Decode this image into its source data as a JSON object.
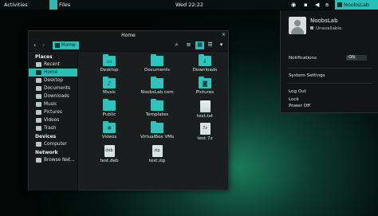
{
  "topbar": {
    "activities": "Activities",
    "app_name": "Files",
    "clock": "Wed 22:22",
    "user": "NoobsLab"
  },
  "window": {
    "title": "Home",
    "close": "×",
    "path": "Home"
  },
  "sidebar": {
    "places_header": "Places",
    "places": [
      {
        "label": "Recent",
        "selected": false
      },
      {
        "label": "Home",
        "selected": true
      },
      {
        "label": "Desktop",
        "selected": false
      },
      {
        "label": "Documents",
        "selected": false
      },
      {
        "label": "Downloads",
        "selected": false
      },
      {
        "label": "Music",
        "selected": false
      },
      {
        "label": "Pictures",
        "selected": false
      },
      {
        "label": "Videos",
        "selected": false
      },
      {
        "label": "Trash",
        "selected": false
      }
    ],
    "devices_header": "Devices",
    "devices": [
      {
        "label": "Computer"
      }
    ],
    "network_header": "Network",
    "network": [
      {
        "label": "Browse Net..."
      }
    ]
  },
  "files": [
    {
      "label": "Desktop",
      "kind": "folder",
      "icon": "desktop-folder-icon",
      "glyph": "▭"
    },
    {
      "label": "Documents",
      "kind": "folder",
      "icon": "documents-folder-icon",
      "glyph": ""
    },
    {
      "label": "Downloads",
      "kind": "folder",
      "icon": "downloads-folder-icon",
      "glyph": "↓"
    },
    {
      "label": "Music",
      "kind": "folder",
      "icon": "music-folder-icon",
      "glyph": "♪"
    },
    {
      "label": "NoobsLab.com",
      "kind": "folder",
      "icon": "folder-icon",
      "glyph": ""
    },
    {
      "label": "Pictures",
      "kind": "folder",
      "icon": "pictures-folder-icon",
      "glyph": "◙"
    },
    {
      "label": "Public",
      "kind": "folder",
      "icon": "public-folder-icon",
      "glyph": ""
    },
    {
      "label": "Templates",
      "kind": "folder",
      "icon": "templates-folder-icon",
      "glyph": ""
    },
    {
      "label": "test.txt",
      "kind": "file",
      "icon": "text-file-icon",
      "glyph": ""
    },
    {
      "label": "Videos",
      "kind": "folder",
      "icon": "videos-folder-icon",
      "glyph": "✲"
    },
    {
      "label": "VirtualBox VMs",
      "kind": "folder",
      "icon": "folder-icon",
      "glyph": ""
    },
    {
      "label": "test.7z",
      "kind": "file",
      "icon": "archive-file-icon",
      "glyph": "7z"
    },
    {
      "label": "test.deb",
      "kind": "file",
      "icon": "deb-package-icon",
      "glyph": "deb"
    },
    {
      "label": "test.zip",
      "kind": "file",
      "icon": "zip-file-icon",
      "glyph": "zip"
    }
  ],
  "panel": {
    "username": "NoobsLab",
    "status": "Unavailable",
    "notifications_label": "Notifications",
    "notifications_toggle": "ON",
    "system_settings": "System Settings",
    "log_out": "Log Out",
    "lock": "Lock",
    "power_off": "Power Off"
  },
  "colors": {
    "accent": "#2bbfb8",
    "window_bg": "#1a1e1f",
    "topbar_bg": "#0a0f10"
  }
}
